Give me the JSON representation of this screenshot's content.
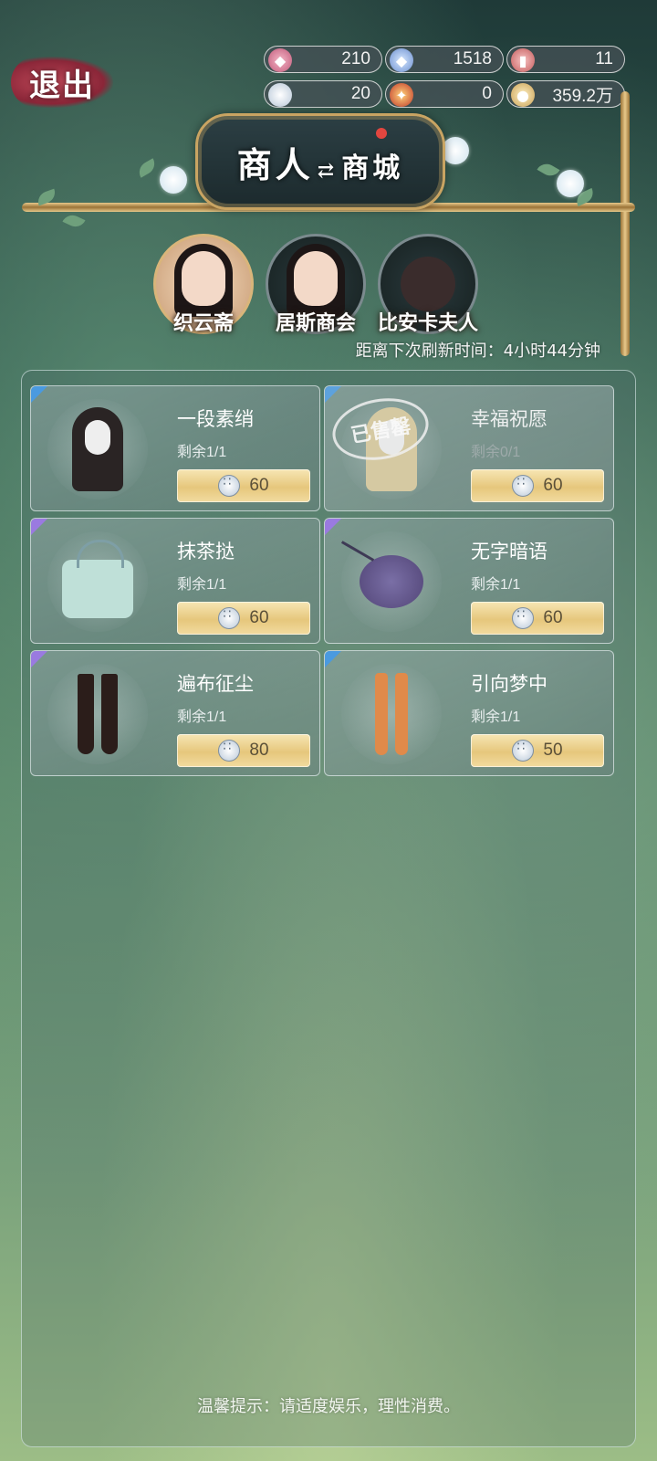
{
  "header": {
    "exit_label": "退出",
    "title_left": "商人",
    "title_swap_icon": "swap-arrows-icon",
    "title_right": "商城"
  },
  "currencies": [
    {
      "icon": "pink-crystal-icon",
      "value": "210"
    },
    {
      "icon": "blue-crystal-icon",
      "value": "1518"
    },
    {
      "icon": "ticket-icon",
      "value": "11"
    },
    {
      "icon": "button-token-icon",
      "value": "20"
    },
    {
      "icon": "red-gem-icon",
      "value": "0"
    },
    {
      "icon": "gold-coin-icon",
      "value": "359.2万"
    }
  ],
  "merchants": [
    {
      "name": "织云斋",
      "active": true
    },
    {
      "name": "居斯商会",
      "active": false
    },
    {
      "name": "比安卡夫人",
      "active": false
    }
  ],
  "refresh_text": "距离下次刷新时间：4小时44分钟",
  "items": [
    {
      "name": "一段素绡",
      "remaining": "剩余1/1",
      "price": "60",
      "sold": false,
      "rarity_color": "#4a9ae0",
      "icon": "black-wig-icon"
    },
    {
      "name": "幸福祝愿",
      "remaining": "剩余0/1",
      "price": "60",
      "sold": true,
      "sold_label": "已售罄",
      "rarity_color": "#4a9ae0",
      "icon": "blonde-wig-icon"
    },
    {
      "name": "抹茶挞",
      "remaining": "剩余1/1",
      "price": "60",
      "sold": false,
      "rarity_color": "#9a7ae0",
      "icon": "handbag-icon"
    },
    {
      "name": "无字暗语",
      "remaining": "剩余1/1",
      "price": "60",
      "sold": false,
      "rarity_color": "#9a7ae0",
      "icon": "fan-icon"
    },
    {
      "name": "遍布征尘",
      "remaining": "剩余1/1",
      "price": "80",
      "sold": false,
      "rarity_color": "#9a7ae0",
      "icon": "boots-icon"
    },
    {
      "name": "引向梦中",
      "remaining": "剩余1/1",
      "price": "50",
      "sold": false,
      "rarity_color": "#4a9ae0",
      "icon": "stockings-icon"
    }
  ],
  "footer_tip": "温馨提示：请适度娱乐，理性消费。"
}
